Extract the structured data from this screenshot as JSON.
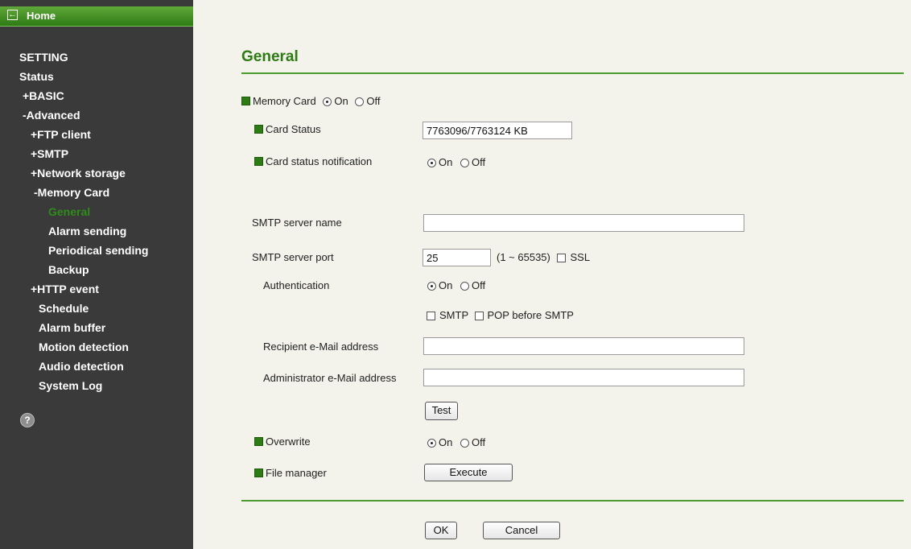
{
  "sidebar": {
    "home_label": "Home",
    "items": [
      {
        "label": "SETTING"
      },
      {
        "label": "Status"
      },
      {
        "label": "+BASIC"
      },
      {
        "label": "-Advanced"
      },
      {
        "label": "+FTP client"
      },
      {
        "label": "+SMTP"
      },
      {
        "label": "+Network storage"
      },
      {
        "label": "-Memory Card"
      },
      {
        "label": "General"
      },
      {
        "label": "Alarm sending"
      },
      {
        "label": "Periodical sending"
      },
      {
        "label": "Backup"
      },
      {
        "label": "+HTTP event"
      },
      {
        "label": "Schedule"
      },
      {
        "label": "Alarm buffer"
      },
      {
        "label": "Motion detection"
      },
      {
        "label": "Audio detection"
      },
      {
        "label": "System Log"
      }
    ],
    "active_color": "#2f8b1a",
    "help_glyph": "?"
  },
  "main": {
    "title": "General",
    "memory_card": {
      "label": "Memory Card",
      "on": "On",
      "off": "Off",
      "value": "On"
    },
    "card_status": {
      "label": "Card Status",
      "value": "7763096/7763124 KB"
    },
    "card_notify": {
      "label": "Card status notification",
      "on": "On",
      "off": "Off",
      "value": "On"
    },
    "smtp_server_name": {
      "label": "SMTP server name",
      "value": ""
    },
    "smtp_server_port": {
      "label": "SMTP server port",
      "value": "25",
      "range": "(1 ~ 65535)",
      "ssl_label": "SSL"
    },
    "authentication": {
      "label": "Authentication",
      "on": "On",
      "off": "Off",
      "value": "On",
      "smtp_label": "SMTP",
      "pop_label": "POP before SMTP"
    },
    "recipient": {
      "label": "Recipient e-Mail address",
      "value": ""
    },
    "administrator": {
      "label": "Administrator e-Mail address",
      "value": ""
    },
    "test_button": "Test",
    "overwrite": {
      "label": "Overwrite",
      "on": "On",
      "off": "Off",
      "value": "On"
    },
    "file_manager": {
      "label": "File manager",
      "button": "Execute"
    },
    "ok_button": "OK",
    "cancel_button": "Cancel"
  },
  "colors": {
    "accent": "#2e7a14",
    "sidebar_bg": "#3a3a3a",
    "page_bg": "#f3f3eb"
  }
}
